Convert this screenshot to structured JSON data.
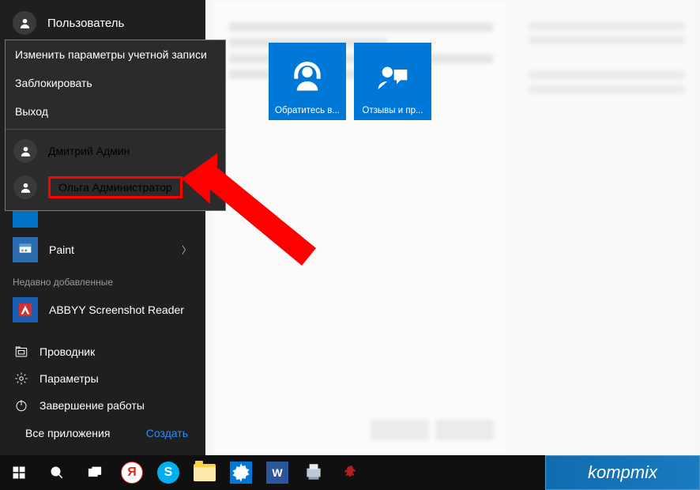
{
  "header": {
    "username": "Пользователь"
  },
  "account_menu": {
    "change_settings": "Изменить параметры учетной записи",
    "lock": "Заблокировать",
    "signout": "Выход",
    "users": [
      {
        "name": "Дмитрий Админ"
      },
      {
        "name": "Ольга Администратор"
      }
    ]
  },
  "tiles": [
    {
      "label": "Обратитесь в..."
    },
    {
      "label": "Отзывы и пр..."
    }
  ],
  "app_list": {
    "paint": "Paint",
    "section_recent": "Недавно добавленные",
    "abbyy": "ABBYY Screenshot Reader"
  },
  "system_links": {
    "explorer": "Проводник",
    "settings": "Параметры",
    "power": "Завершение работы",
    "all_apps": "Все приложения",
    "create": "Создать"
  },
  "watermark": "kompmix"
}
